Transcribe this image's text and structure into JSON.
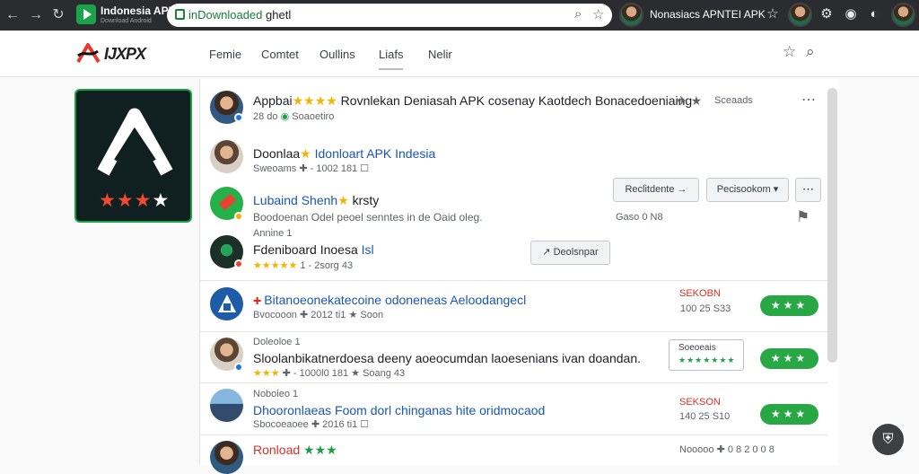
{
  "browser": {
    "tab_title": "Indonesia APK",
    "tab_subtitle": "Download Android",
    "url_host": "inDownloaded",
    "url_path": " ghetl",
    "extension_title": "Nonasiacs APNTEI APK",
    "icons": [
      "back-icon",
      "forward-icon",
      "refresh-icon",
      "search-icon",
      "star-icon",
      "profile-icon",
      "menu-icon"
    ]
  },
  "site": {
    "logo_text": "IJXPX",
    "nav": [
      "Femie",
      "Comtet",
      "Oullins",
      "Liafs",
      "Nelir"
    ],
    "active_nav_index": 3,
    "colors": {
      "brand_red": "#d93025",
      "brand_green": "#1e9c4b",
      "accent_blue": "#1a56b4",
      "star_yellow": "#f4b400"
    }
  },
  "featured_app": {
    "rating_stars": "★★★",
    "rating_outline": "★"
  },
  "items": [
    {
      "title": "Appbai",
      "title_rest": " Rovnlekan Deniasah APK cosenay Kaotdech Bonacedoeniaing",
      "stars": "★★★★",
      "meta": "28 do",
      "meta_extra": "Soaoetiro",
      "right_label": "Sceaads"
    },
    {
      "title": "Doonlaa",
      "title_blue": " Idonloart APK Indesia",
      "meta": "Sweoams  ✚ - 1002 181  ☐"
    },
    {
      "title": "Lubaind Shenh",
      "title_rest": " krsty",
      "meta": "Boodoenan Odel peoel senntes in de Oaid oleg.",
      "side_meta": "Gaso  0  N8",
      "button_primary": "Reclitdente  →",
      "button_select": "Pecisookom ▾"
    },
    {
      "title_pre": "Annine  1",
      "title": "Fdeniboard Inoesa",
      "title_blue": " Isl",
      "stars": "★★★★★",
      "meta": "1 - 2sorg  43",
      "button": "Deolsnpar"
    },
    {
      "title": "Bitanoeonekatecoine odoneneas Aeloodangecl",
      "meta": "Bvocooon  ✚  2012 ti1   ★ Soon",
      "side_red": "SEKOBN",
      "side_meta": "100 25 S33",
      "rating": "★★★"
    },
    {
      "title_pre": "Doleoloe  1",
      "title": "Sloolanbikatnerdoesa deeny aoeocumdan laoesenians ivan doandan.",
      "stars": "★★★",
      "meta": "✚ - 1000l0 181  ★  Soang  43",
      "button_top": "Soeoeais",
      "button_stars": "★★★★★★★",
      "rating": "★★★"
    },
    {
      "title_pre": "Noboieo  1",
      "title": "Dhooronlaeas Foom dorl chinganas hite oridmocaod",
      "meta": "Sbocoeaoee  ✚  2016 ti1  ☐",
      "side_red": "SEKSON",
      "side_meta": "140 25 S10",
      "rating": "★★★"
    },
    {
      "title": "Ronload",
      "stars": "★★★",
      "side_meta": "Nooooo  ✚  0 8 2 0 0 8"
    }
  ],
  "fab_icon": "shield-icon"
}
